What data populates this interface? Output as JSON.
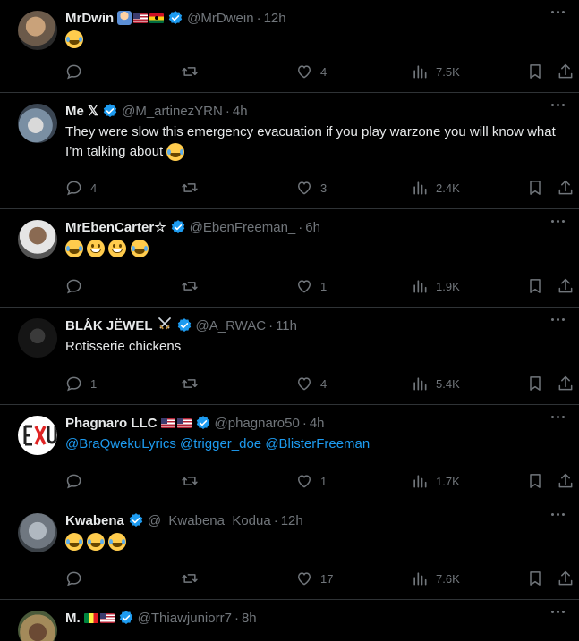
{
  "tweets": [
    {
      "name": "MrDwin",
      "handle": "@MrDwein",
      "time": "12h",
      "text": "",
      "emoji": [
        "face-with-tears-of-joy"
      ],
      "badges": [
        "technologist",
        "flag-us",
        "flag-gh"
      ],
      "replies": "",
      "likes": "4",
      "views": "7.5K"
    },
    {
      "name": "Me 𝕏",
      "handle": "@M_artinezYRN",
      "time": "4h",
      "text": "They were slow this emergency evacuation if you play warzone you will know what I’m talking about",
      "emoji": [
        "face-with-tears-of-joy"
      ],
      "badges": [],
      "replies": "4",
      "likes": "3",
      "views": "2.4K"
    },
    {
      "name": "MrEbenCarter☆",
      "handle": "@EbenFreeman_",
      "time": "6h",
      "text": "",
      "emoji": [
        "face-with-tears-of-joy",
        "grinning-face",
        "grinning-face",
        "face-with-tears-of-joy"
      ],
      "badges": [],
      "replies": "",
      "likes": "1",
      "views": "1.9K"
    },
    {
      "name": "BLÅK JËWEL",
      "handle": "@A_RWAC",
      "time": "11h",
      "text": "Rotisserie chickens",
      "emoji": [],
      "badges": [
        "crossed-swords"
      ],
      "replies": "1",
      "likes": "4",
      "views": "5.4K"
    },
    {
      "name": "Phagnaro LLC",
      "handle": "@phagnaro50",
      "time": "4h",
      "text": "",
      "mentions": "@BraQwekuLyrics @trigger_doe @BlisterFreeman",
      "emoji": [],
      "badges": [
        "flag-us",
        "flag-us"
      ],
      "replies": "",
      "likes": "1",
      "views": "1.7K"
    },
    {
      "name": "Kwabena",
      "handle": "@_Kwabena_Kodua",
      "time": "12h",
      "text": "",
      "emoji": [
        "face-with-tears-of-joy",
        "face-with-tears-of-joy",
        "face-with-tears-of-joy"
      ],
      "badges": [],
      "replies": "",
      "likes": "17",
      "views": "7.6K"
    },
    {
      "name": "M.",
      "handle": "@Thiawjuniorr7",
      "time": "8h",
      "text": "",
      "emoji": [],
      "badges": [
        "flag-sn",
        "flag-us"
      ],
      "replies": "",
      "likes": "",
      "views": ""
    }
  ],
  "colors": {
    "background": "#000000",
    "text": "#e7e9ea",
    "muted": "#71767b",
    "verified": "#1d9bf0",
    "link": "#1d9bf0",
    "divider": "#2f3336"
  },
  "icons": [
    "reply-icon",
    "retweet-icon",
    "like-icon",
    "views-icon",
    "bookmark-icon",
    "share-icon",
    "more-icon",
    "verified-icon"
  ]
}
